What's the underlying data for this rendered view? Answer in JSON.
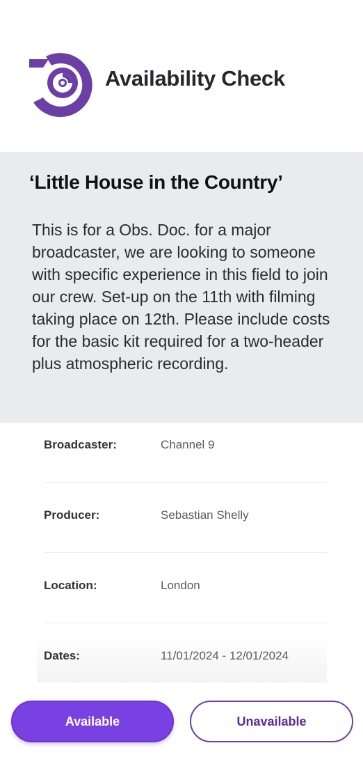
{
  "header": {
    "title": "Availability Check"
  },
  "brief": {
    "title": "‘Little House in the Country’",
    "description": "This is for a Obs. Doc. for a major broadcaster, we are looking to someone with specific experience in this field to join our crew. Set-up on the 11th with filming taking place on 12th. Please include costs for the basic kit required for a two-header plus atmospheric recording."
  },
  "details": [
    {
      "label": "Broadcaster:",
      "value": "Channel 9"
    },
    {
      "label": "Producer:",
      "value": "Sebastian Shelly"
    },
    {
      "label": "Location:",
      "value": "London"
    },
    {
      "label": "Dates:",
      "value": "11/01/2024 - 12/01/2024"
    }
  ],
  "actions": {
    "available_label": "Available",
    "unavailable_label": "Unavailable"
  },
  "colors": {
    "accent": "#7a41e2",
    "logo": "#6b3fa6",
    "brief_background": "#e8ecef"
  },
  "icons": {
    "logo": "disc-logo-icon"
  }
}
